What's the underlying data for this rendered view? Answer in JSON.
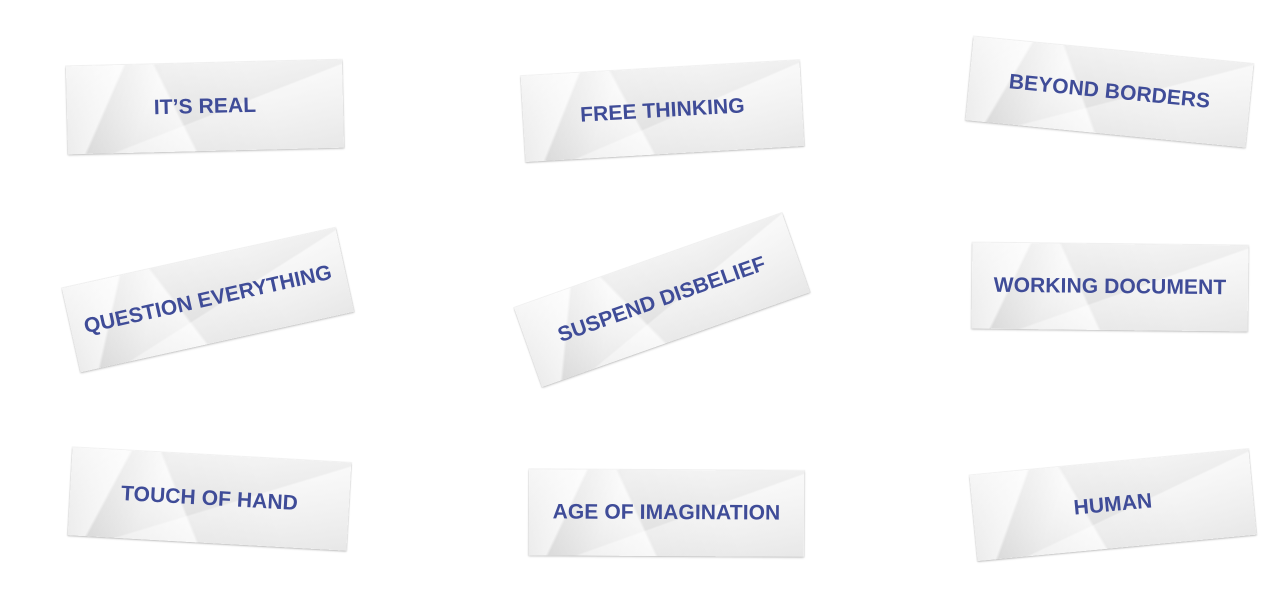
{
  "labels": [
    {
      "text": "IT’S REAL"
    },
    {
      "text": "FREE THINKING"
    },
    {
      "text": "BEYOND BORDERS"
    },
    {
      "text": "QUESTION EVERYTHING"
    },
    {
      "text": "SUSPEND DISBELIEF"
    },
    {
      "text": "WORKING DOCUMENT"
    },
    {
      "text": "TOUCH OF HAND"
    },
    {
      "text": "AGE OF IMAGINATION"
    },
    {
      "text": "HUMAN"
    }
  ],
  "colors": {
    "text": "#3f4c98",
    "paper": "#f2f2f2",
    "background": "#ffffff"
  }
}
